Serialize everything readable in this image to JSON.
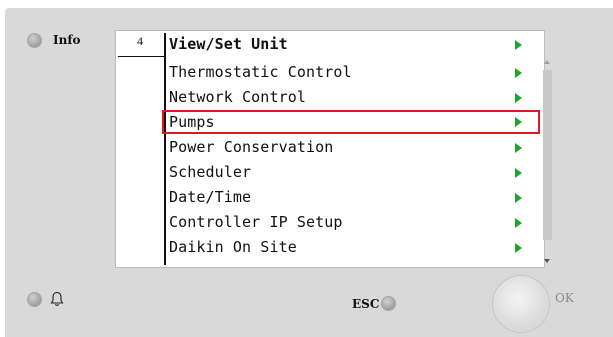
{
  "device": {
    "info_label": "Info",
    "esc_label": "ESC",
    "ok_label": "OK"
  },
  "screen": {
    "page_number": "4",
    "title": "View/Set Unit",
    "selected_index": 2,
    "items": [
      {
        "label": "Thermostatic Control"
      },
      {
        "label": "Network Control"
      },
      {
        "label": "Pumps"
      },
      {
        "label": "Power Conservation"
      },
      {
        "label": "Scheduler"
      },
      {
        "label": "Date/Time"
      },
      {
        "label": "Controller IP Setup"
      },
      {
        "label": "Daikin On Site"
      }
    ]
  },
  "icons": {
    "bell": "bell-icon",
    "arrow": "right-arrow-icon"
  },
  "colors": {
    "arrow": "#1ea52b",
    "selection": "#e0181f",
    "panel": "#d9d9d9"
  }
}
